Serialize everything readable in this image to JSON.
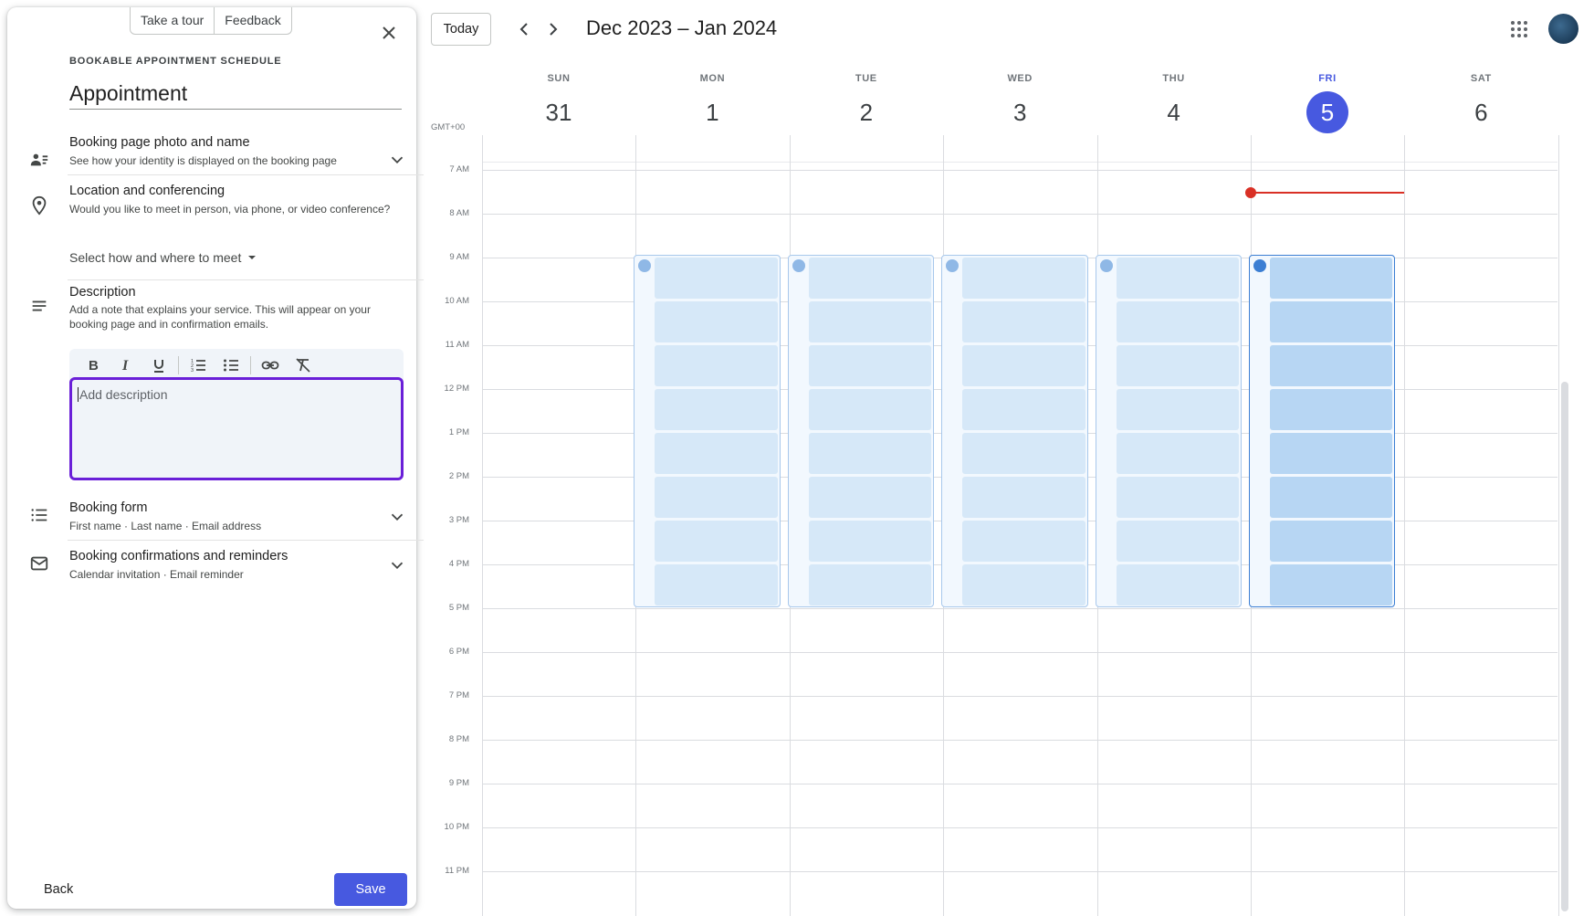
{
  "panel": {
    "tour_label": "Take a tour",
    "feedback_label": "Feedback",
    "kicker": "BOOKABLE APPOINTMENT SCHEDULE",
    "title": "Appointment",
    "sections": {
      "photo": {
        "title": "Booking page photo and name",
        "subtitle": "See how your identity is displayed on the booking page"
      },
      "location": {
        "title": "Location and conferencing",
        "subtitle": "Would you like to meet in person, via phone, or video conference?",
        "select_label": "Select how and where to meet"
      },
      "description": {
        "title": "Description",
        "subtitle_line1": "Add a note that explains your service. This will appear on your",
        "subtitle_line2": "booking page and in confirmation emails.",
        "placeholder": "Add description"
      },
      "form": {
        "title": "Booking form",
        "subtitle": "First name · Last name · Email address"
      },
      "confirm": {
        "title": "Booking confirmations and reminders",
        "subtitle": "Calendar invitation · Email reminder"
      }
    },
    "back_label": "Back",
    "save_label": "Save"
  },
  "calendar": {
    "today_label": "Today",
    "range": "Dec 2023 – Jan 2024",
    "timezone": "GMT+00",
    "days": [
      {
        "name": "SUN",
        "num": "31"
      },
      {
        "name": "MON",
        "num": "1"
      },
      {
        "name": "TUE",
        "num": "2"
      },
      {
        "name": "WED",
        "num": "3"
      },
      {
        "name": "THU",
        "num": "4"
      },
      {
        "name": "FRI",
        "num": "5"
      },
      {
        "name": "SAT",
        "num": "6"
      }
    ],
    "current_day": "FRI",
    "hours": [
      "7 AM",
      "8 AM",
      "9 AM",
      "10 AM",
      "11 AM",
      "12 PM",
      "1 PM",
      "2 PM",
      "3 PM",
      "4 PM",
      "5 PM",
      "6 PM",
      "7 PM",
      "8 PM",
      "9 PM",
      "10 PM",
      "11 PM"
    ],
    "availability": {
      "days": [
        "MON",
        "TUE",
        "WED",
        "THU",
        "FRI"
      ],
      "start": "9 AM",
      "end": "5 PM",
      "selected_day": "FRI"
    },
    "accent": "#4759e0",
    "now_color": "#d93025"
  }
}
